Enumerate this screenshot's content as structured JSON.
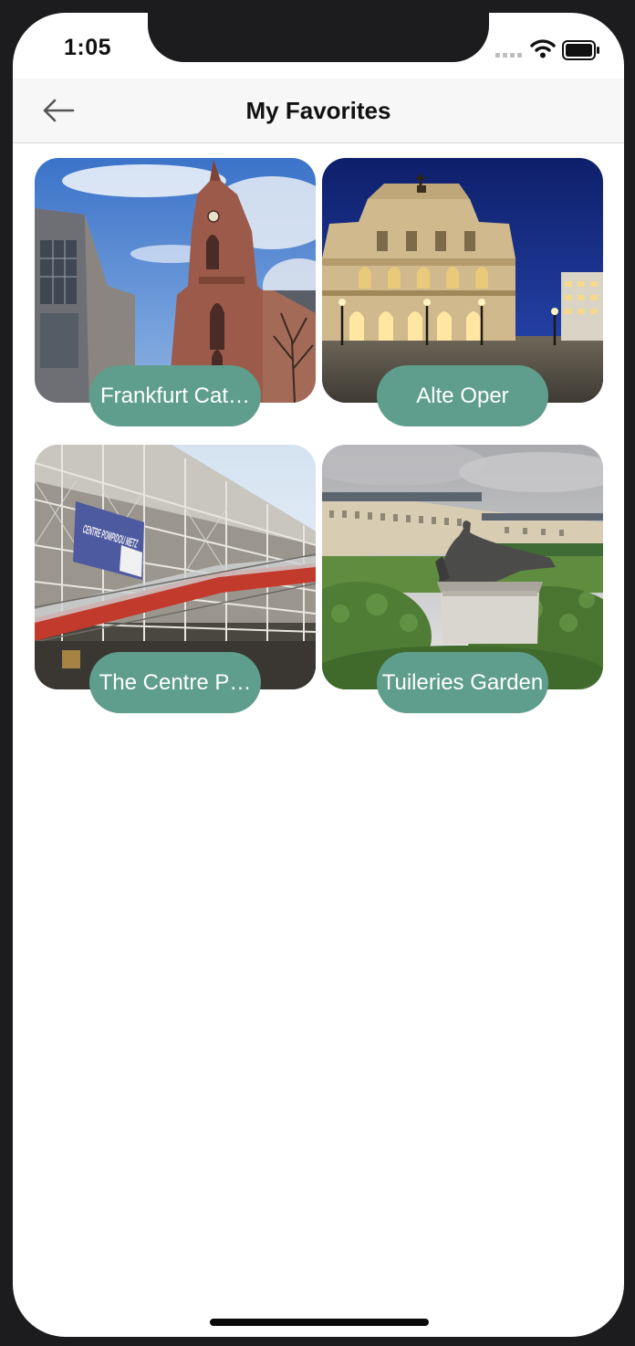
{
  "status_bar": {
    "time": "1:05"
  },
  "header": {
    "title": "My Favorites"
  },
  "favorites": [
    {
      "label": "Frankfurt Cat…",
      "image": "frankfurt-cathedral-photo"
    },
    {
      "label": "Alte Oper",
      "image": "alte-oper-photo"
    },
    {
      "label": "The Centre P…",
      "image": "centre-pompidou-photo"
    },
    {
      "label": "Tuileries Garden",
      "image": "tuileries-garden-photo"
    }
  ],
  "poster_text": "CENTRE POMPIDOU METZ",
  "colors": {
    "pill": "#5f9e8c",
    "background": "#ffffff",
    "frame": "#1c1c1e"
  }
}
